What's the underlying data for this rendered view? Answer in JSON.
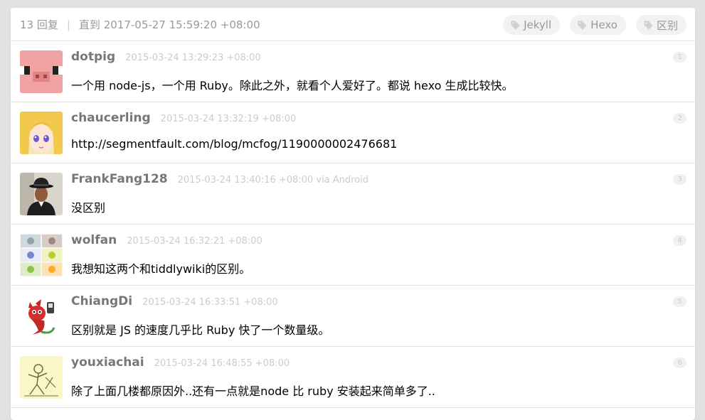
{
  "header": {
    "reply_count": "13 回复",
    "separator": "|",
    "last_reply": "直到 2017-05-27 15:59:20 +08:00"
  },
  "tags": [
    {
      "label": "Jekyll",
      "icon": "tag-icon"
    },
    {
      "label": "Hexo",
      "icon": "tag-icon"
    },
    {
      "label": "区别",
      "icon": "tag-icon"
    }
  ],
  "replies": [
    {
      "username": "dotpig",
      "time": "2015-03-24 13:29:23 +08:00",
      "content": "一个用 node-js，一个用 Ruby。除此之外，就看个人爱好了。都说 hexo 生成比较快。",
      "floor": "1"
    },
    {
      "username": "chaucerling",
      "time": "2015-03-24 13:32:19 +08:00",
      "content": "http://segmentfault.com/blog/mcfog/1190000002476681",
      "floor": "2"
    },
    {
      "username": "FrankFang128",
      "time": "2015-03-24 13:40:16 +08:00 via Android",
      "content": "没区别",
      "floor": "3"
    },
    {
      "username": "wolfan",
      "time": "2015-03-24 16:32:21 +08:00",
      "content": "我想知这两个和tiddlywiki的区别。",
      "floor": "4"
    },
    {
      "username": "ChiangDi",
      "time": "2015-03-24 16:33:51 +08:00",
      "content": "区别就是 JS 的速度几乎比 Ruby 快了一个数量级。",
      "floor": "5"
    },
    {
      "username": "youxiachai",
      "time": "2015-03-24 16:48:55 +08:00",
      "content": "除了上面几楼都原因外..还有一点就是node 比 ruby 安装起来简单多了..",
      "floor": "6"
    }
  ],
  "colors": {
    "background": "#e2e2e2",
    "username": "#777777",
    "meta": "#cccccc",
    "tag_bg": "#f2f2f2"
  }
}
